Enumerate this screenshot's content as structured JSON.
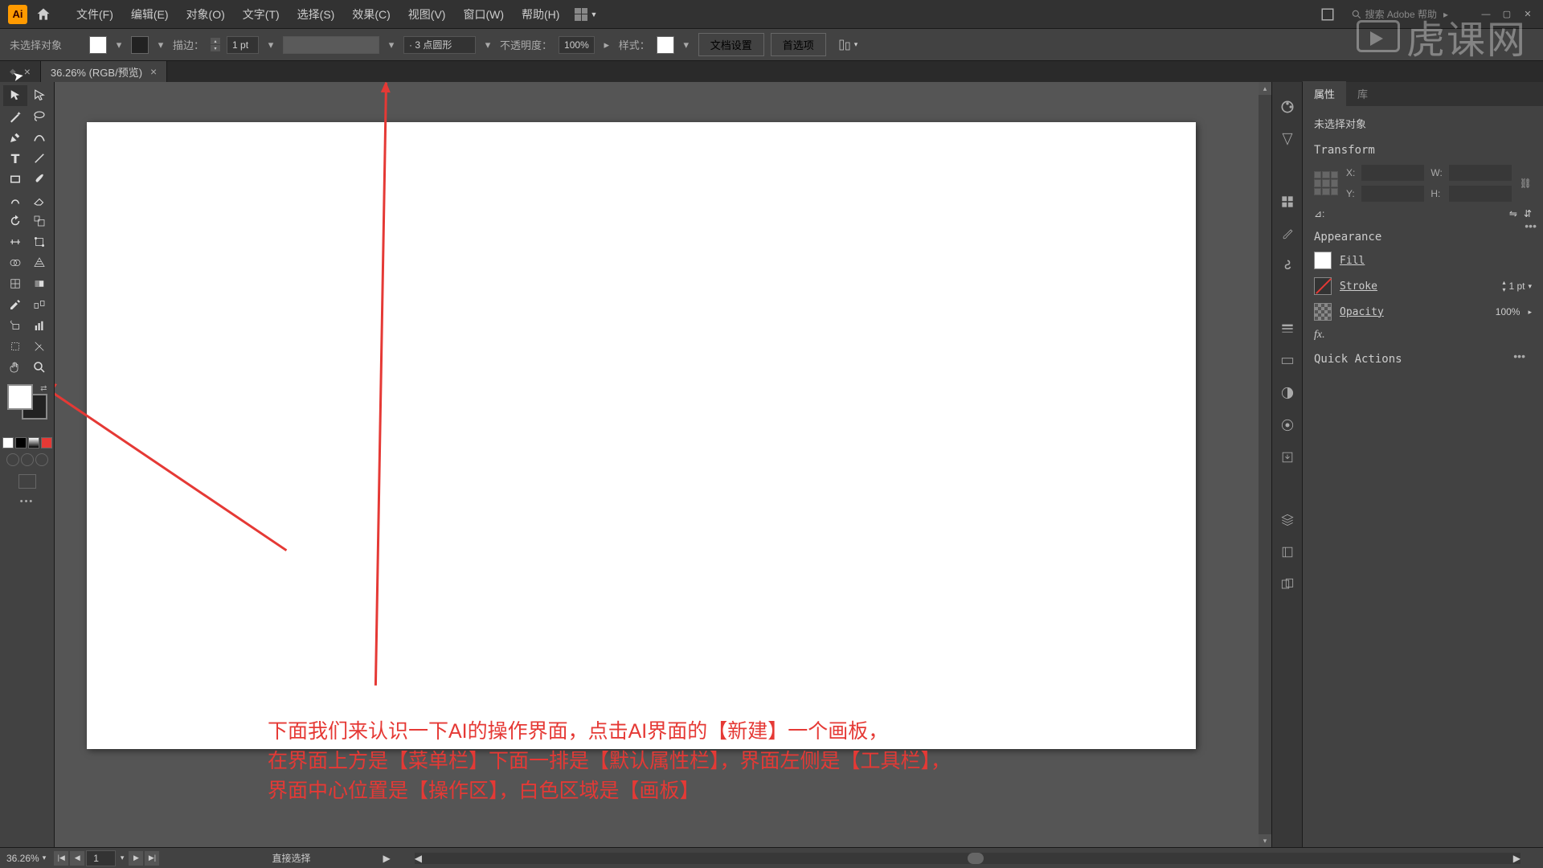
{
  "menu": {
    "file": "文件(F)",
    "edit": "编辑(E)",
    "object": "对象(O)",
    "type": "文字(T)",
    "select": "选择(S)",
    "effect": "效果(C)",
    "view": "视图(V)",
    "window": "窗口(W)",
    "help": "帮助(H)"
  },
  "search": {
    "placeholder": "搜索 Adobe 帮助"
  },
  "optbar": {
    "noSelection": "未选择对象",
    "strokeLabel": "描边：",
    "strokeValue": "1 pt",
    "brushLabel": "· 3 点圆形",
    "opacityLabel": "不透明度：",
    "opacityValue": "100%",
    "styleLabel": "样式：",
    "docSetup": "文档设置",
    "prefs": "首选项"
  },
  "tab": {
    "title": "36.26% (RGB/预览)"
  },
  "caption": {
    "line1": "下面我们来认识一下AI的操作界面，点击AI界面的【新建】一个画板，",
    "line2": "在界面上方是【菜单栏】下面一排是【默认属性栏】，界面左侧是【工具栏】，",
    "line3": "界面中心位置是【操作区】，白色区域是【画板】"
  },
  "panel": {
    "tabProps": "属性",
    "tabLib": "库",
    "noSelection": "未选择对象",
    "transform": "Transform",
    "X": "X:",
    "Y": "Y:",
    "W": "W:",
    "H": "H:",
    "angle": "⊿:",
    "appearance": "Appearance",
    "fill": "Fill",
    "stroke": "Stroke",
    "strokeValue": "1 pt",
    "opacity": "Opacity",
    "opacityValue": "100%",
    "fx": "fx.",
    "quickActions": "Quick Actions"
  },
  "status": {
    "zoom": "36.26%",
    "artboard": "1",
    "tool": "直接选择"
  },
  "watermark": "虎课网"
}
